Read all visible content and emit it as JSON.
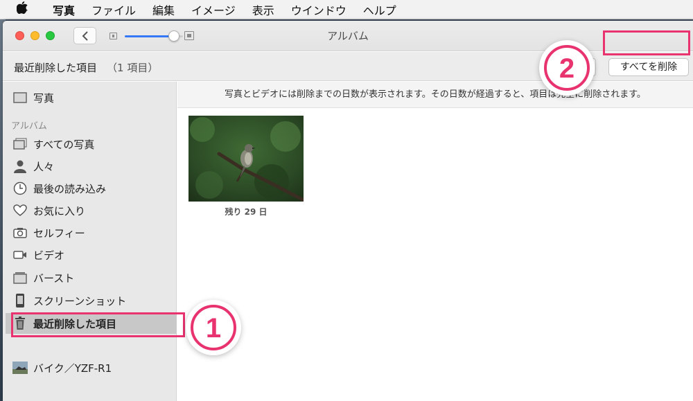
{
  "menubar": {
    "apple": "",
    "items": [
      "写真",
      "ファイル",
      "編集",
      "イメージ",
      "表示",
      "ウインドウ",
      "ヘルプ"
    ]
  },
  "window": {
    "title": "アルバム",
    "zoom_level": 0.85
  },
  "toolbar": {
    "title": "最近削除した項目",
    "count": "（1 項目）",
    "delete_all_label": "すべてを削除"
  },
  "annotations": {
    "badge_1": "1",
    "badge_2": "2",
    "highlight_color": "#e8336f"
  },
  "sidebar": {
    "top_item": {
      "label": "写真",
      "icon": "photos-icon"
    },
    "album_header": "アルバム",
    "items": [
      {
        "label": "すべての写真",
        "icon": "all-photos-icon"
      },
      {
        "label": "人々",
        "icon": "person-icon"
      },
      {
        "label": "最後の読み込み",
        "icon": "clock-icon"
      },
      {
        "label": "お気に入り",
        "icon": "heart-icon"
      },
      {
        "label": "セルフィー",
        "icon": "camera-icon"
      },
      {
        "label": "ビデオ",
        "icon": "video-icon"
      },
      {
        "label": "バースト",
        "icon": "burst-icon"
      },
      {
        "label": "スクリーンショット",
        "icon": "phone-icon"
      },
      {
        "label": "最近削除した項目",
        "icon": "trash-icon",
        "selected": true
      },
      {
        "label": "バイク／YZF-R1",
        "icon": "album-thumbnail-icon"
      }
    ]
  },
  "main": {
    "info_text": "写真とビデオには削除までの日数が表示されます。その日数が経過すると、項目は完全に削除されます。",
    "photos": [
      {
        "caption": "残り 29 日"
      }
    ]
  }
}
